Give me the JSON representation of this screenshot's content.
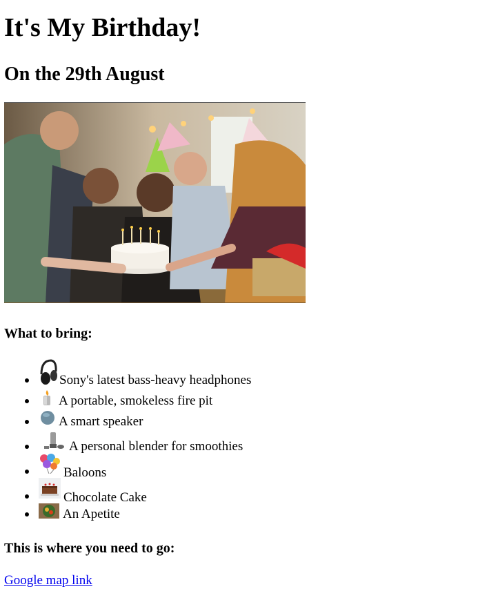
{
  "title": "It's My Birthday!",
  "date_heading": "On the 29th August",
  "photo": {
    "icon": "birthday-party-photo"
  },
  "bring_heading": "What to bring:",
  "items": [
    {
      "label": "Sony's latest bass-heavy headphones",
      "icon": "headphones-icon"
    },
    {
      "label": "A portable, smokeless fire pit",
      "icon": "fire-pit-icon"
    },
    {
      "label": "A smart speaker",
      "icon": "smart-speaker-icon"
    },
    {
      "label": "A personal blender for smoothies",
      "icon": "blender-icon"
    },
    {
      "label": "Baloons",
      "icon": "balloons-icon"
    },
    {
      "label": "Chocolate Cake",
      "icon": "cake-icon"
    },
    {
      "label": "An Apetite",
      "icon": "food-plate-icon"
    }
  ],
  "go_heading": "This is where you need to go:",
  "map_link": "Google map link"
}
